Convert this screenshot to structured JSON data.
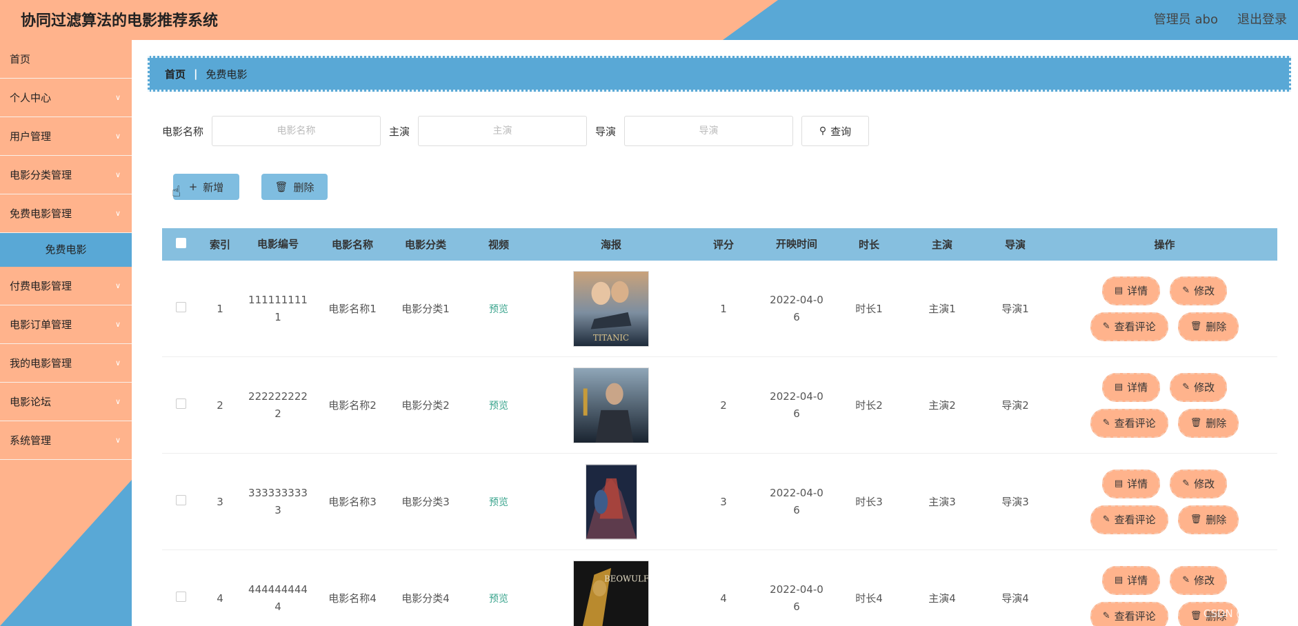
{
  "header": {
    "title": "协同过滤算法的电影推荐系统",
    "user": "管理员 abo",
    "logout": "退出登录"
  },
  "sidebar": {
    "items": [
      {
        "label": "首页"
      },
      {
        "label": "个人中心"
      },
      {
        "label": "用户管理"
      },
      {
        "label": "电影分类管理"
      },
      {
        "label": "免费电影管理"
      },
      {
        "label": "付费电影管理"
      },
      {
        "label": "电影订单管理"
      },
      {
        "label": "我的电影管理"
      },
      {
        "label": "电影论坛"
      },
      {
        "label": "系统管理"
      }
    ],
    "active_sub": "免费电影",
    "chevron": "∨"
  },
  "breadcrumb": {
    "home": "首页",
    "sep": "|",
    "current": "免费电影"
  },
  "search": {
    "name_label": "电影名称",
    "name_placeholder": "电影名称",
    "actor_label": "主演",
    "actor_placeholder": "主演",
    "director_label": "导演",
    "director_placeholder": "导演",
    "query_label": "查询"
  },
  "actions": {
    "add_label": "新增",
    "delete_label": "删除"
  },
  "table": {
    "headers": [
      "索引",
      "电影编号",
      "电影名称",
      "电影分类",
      "视频",
      "海报",
      "评分",
      "开映时间",
      "时长",
      "主演",
      "导演",
      "操作"
    ],
    "rows": [
      {
        "idx": "1",
        "code_a": "111111111",
        "code_b": "1",
        "name": "电影名称1",
        "cat": "电影分类1",
        "video": "预览",
        "poster_text": "TITANIC",
        "score": "1",
        "date_a": "2022-04-0",
        "date_b": "6",
        "dur": "时长1",
        "actor": "主演1",
        "dir": "导演1"
      },
      {
        "idx": "2",
        "code_a": "222222222",
        "code_b": "2",
        "name": "电影名称2",
        "cat": "电影分类2",
        "video": "预览",
        "poster_text": "",
        "score": "2",
        "date_a": "2022-04-0",
        "date_b": "6",
        "dur": "时长2",
        "actor": "主演2",
        "dir": "导演2"
      },
      {
        "idx": "3",
        "code_a": "333333333",
        "code_b": "3",
        "name": "电影名称3",
        "cat": "电影分类3",
        "video": "预览",
        "poster_text": "",
        "score": "3",
        "date_a": "2022-04-0",
        "date_b": "6",
        "dur": "时长3",
        "actor": "主演3",
        "dir": "导演3"
      },
      {
        "idx": "4",
        "code_a": "444444444",
        "code_b": "4",
        "name": "电影名称4",
        "cat": "电影分类4",
        "video": "预览",
        "poster_text": "BEOWULF",
        "score": "4",
        "date_a": "2022-04-0",
        "date_b": "6",
        "dur": "时长4",
        "actor": "主演4",
        "dir": "导演4"
      }
    ],
    "ops": {
      "detail": "详情",
      "edit": "修改",
      "comments": "查看评论",
      "delete": "删除"
    }
  },
  "watermark": "CSDN @IT狂编师",
  "colors": {
    "peach": "#ffb38c",
    "blue": "#59a8d6",
    "table_head": "#86bfdf",
    "link_green": "#3aa48d"
  }
}
